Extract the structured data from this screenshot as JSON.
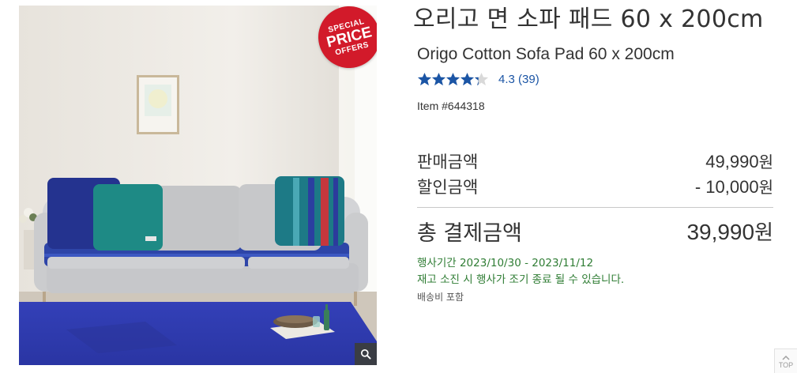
{
  "product": {
    "title_ko": "오리고 면 소파 패드 60 x 200cm",
    "title_en": "Origo Cotton Sofa Pad 60 x 200cm",
    "rating_value": 4.3,
    "rating_text": "4.3 (39)",
    "item_number": "Item #644318",
    "image_icon": "sofa-photo",
    "badge": {
      "line1": "SPECIAL",
      "line2": "PRICE",
      "line3": "OFFERS",
      "color": "#d21a2a"
    }
  },
  "pricing": {
    "sale_label": "판매금액",
    "sale_value": "49,990",
    "discount_label": "할인금액",
    "discount_value": "- 10,000",
    "total_label": "총 결제금액",
    "total_value": "39,990",
    "currency": "원"
  },
  "promo": {
    "period": "행사기간 2023/10/30 - 2023/11/12",
    "notice": "재고 소진 시 행사가 조기 종료 될 수 있습니다.",
    "shipping": "배송비 포함",
    "color": "#2f7d34"
  },
  "colors": {
    "star": "#1b55a5",
    "link": "#1b55a5"
  },
  "icons": {
    "zoom": "magnifier-icon",
    "top": "chevron-up-icon"
  },
  "top_button": {
    "label": "TOP"
  }
}
